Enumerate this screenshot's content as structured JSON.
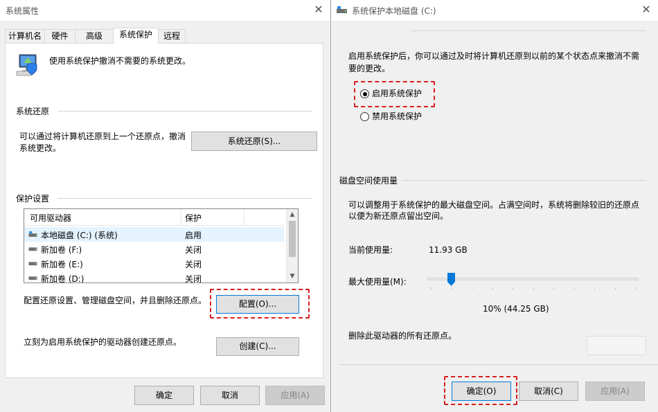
{
  "left": {
    "title": "系统属性",
    "tabs": [
      "计算机名",
      "硬件",
      "高级",
      "系统保护",
      "远程"
    ],
    "intro": "使用系统保护撤消不需要的系统更改。",
    "restore": {
      "heading": "系统还原",
      "desc_line1": "可以通过将计算机还原到上一个还原点，撤消",
      "desc_line2": "系统更改。",
      "button": "系统还原(S)..."
    },
    "protection": {
      "heading": "保护设置",
      "columns": [
        "可用驱动器",
        "保护"
      ],
      "rows": [
        {
          "name": "本地磁盘 (C:) (系统)",
          "status": "启用"
        },
        {
          "name": "新加卷 (F:)",
          "status": "关闭"
        },
        {
          "name": "新加卷 (E:)",
          "status": "关闭"
        },
        {
          "name": "新加卷 (D:)",
          "status": "关闭"
        }
      ]
    },
    "configure": {
      "desc": "配置还原设置、管理磁盘空间，并且删除还原点。",
      "button": "配置(O)..."
    },
    "create": {
      "desc": "立刻为启用系统保护的驱动器创建还原点。",
      "button": "创建(C)..."
    },
    "footer": {
      "ok": "确定",
      "cancel": "取消",
      "apply": "应用(A)"
    }
  },
  "right": {
    "title": "系统保护本地磁盘 (C:)",
    "desc_line1": "启用系统保护后，你可以通过及时将计算机还原到以前的某个状态点来撤消不需",
    "desc_line2": "要的更改。",
    "options": {
      "enable": "启用系统保护",
      "disable": "禁用系统保护",
      "selected": "enable"
    },
    "disk": {
      "heading": "磁盘空间使用量",
      "desc_line1": "可以调整用于系统保护的最大磁盘空间。占满空间时，系统将删除较旧的还原点",
      "desc_line2": "以便为新还原点留出空间。",
      "current_label": "当前使用量:",
      "current_value": "11.93 GB",
      "max_label": "最大使用量(M):",
      "max_fraction": 0.1,
      "max_value_text": "10% (44.25 GB)",
      "delete_desc": "删除此驱动器的所有还原点。",
      "delete_button": ""
    },
    "footer": {
      "ok": "确定(O)",
      "cancel": "取消(C)",
      "apply": "应用(A)"
    }
  },
  "colors": {
    "highlight": "#d81e1e",
    "accent": "#0078d7"
  }
}
